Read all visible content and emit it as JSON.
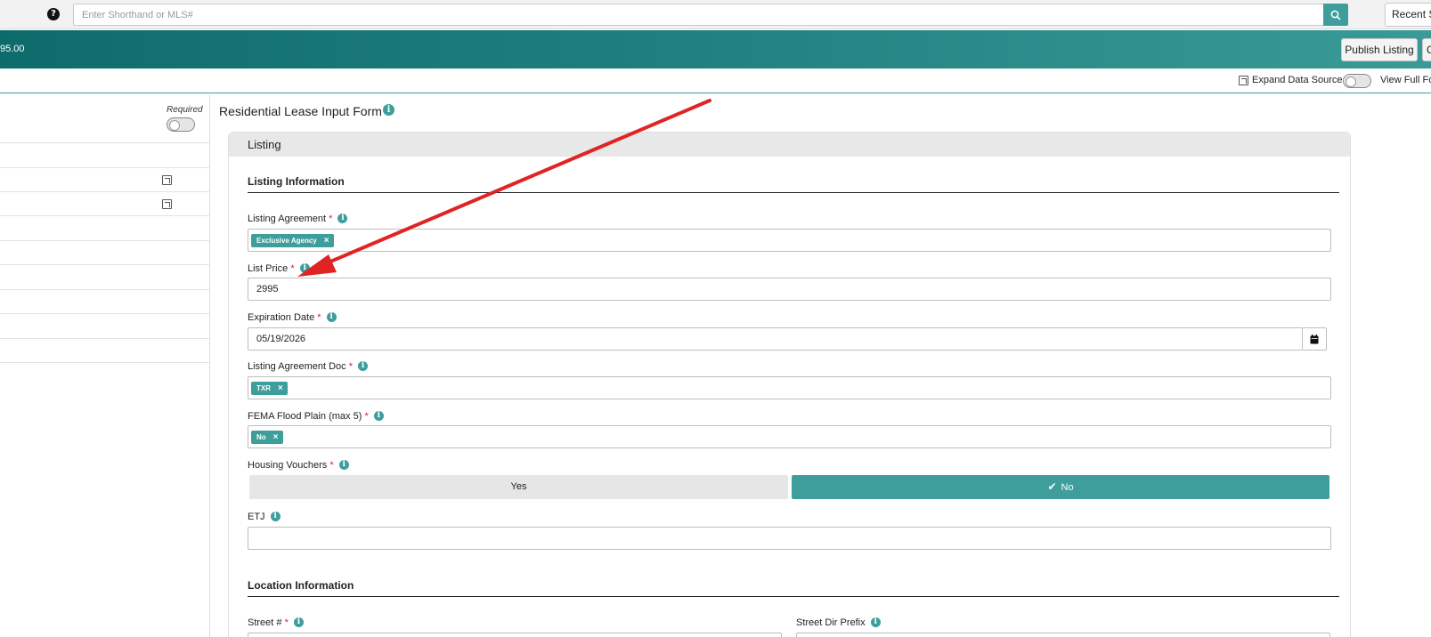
{
  "topbar": {
    "search": {
      "placeholder": "Enter Shorthand or MLS#",
      "value": ""
    },
    "recent_label": "Recent Se"
  },
  "header": {
    "price_summary": "95.00",
    "publish_label": "Publish Listing",
    "cut_button_label": "C"
  },
  "options": {
    "expand_label": "Expand Data Source",
    "view_full_label": "View Full Fo"
  },
  "sidebar": {
    "required_label": "Required"
  },
  "form": {
    "title": "Residential Lease Input Form",
    "panel_title": "Listing",
    "sections": {
      "listing_info": "Listing Information",
      "location_info": "Location Information"
    },
    "fields": {
      "listing_agreement": {
        "label": "Listing Agreement",
        "tag": "Exclusive Agency"
      },
      "list_price": {
        "label": "List Price",
        "value": "2995"
      },
      "expiration_date": {
        "label": "Expiration Date",
        "value": "05/19/2026"
      },
      "listing_agreement_doc": {
        "label": "Listing Agreement Doc",
        "tag": "TXR"
      },
      "fema_flood_plain": {
        "label": "FEMA Flood Plain (max 5)",
        "tag": "No"
      },
      "housing_vouchers": {
        "label": "Housing Vouchers",
        "yes": "Yes",
        "no": "No",
        "selected": "No"
      },
      "etj": {
        "label": "ETJ",
        "value": ""
      },
      "street_number": {
        "label": "Street #"
      },
      "street_dir_prefix": {
        "label": "Street Dir Prefix"
      }
    },
    "required_marker": "*",
    "tag_remove": "×",
    "info_glyph": "i"
  },
  "colors": {
    "accent": "#3d9e9b",
    "header_dark": "#0e6b6b",
    "required": "#d9232d",
    "annotation_arrow": "#e02424"
  },
  "icons": [
    "help-icon",
    "search-icon",
    "info-icon",
    "calendar-icon",
    "check-icon",
    "expand-icon",
    "remove-tag-icon"
  ]
}
